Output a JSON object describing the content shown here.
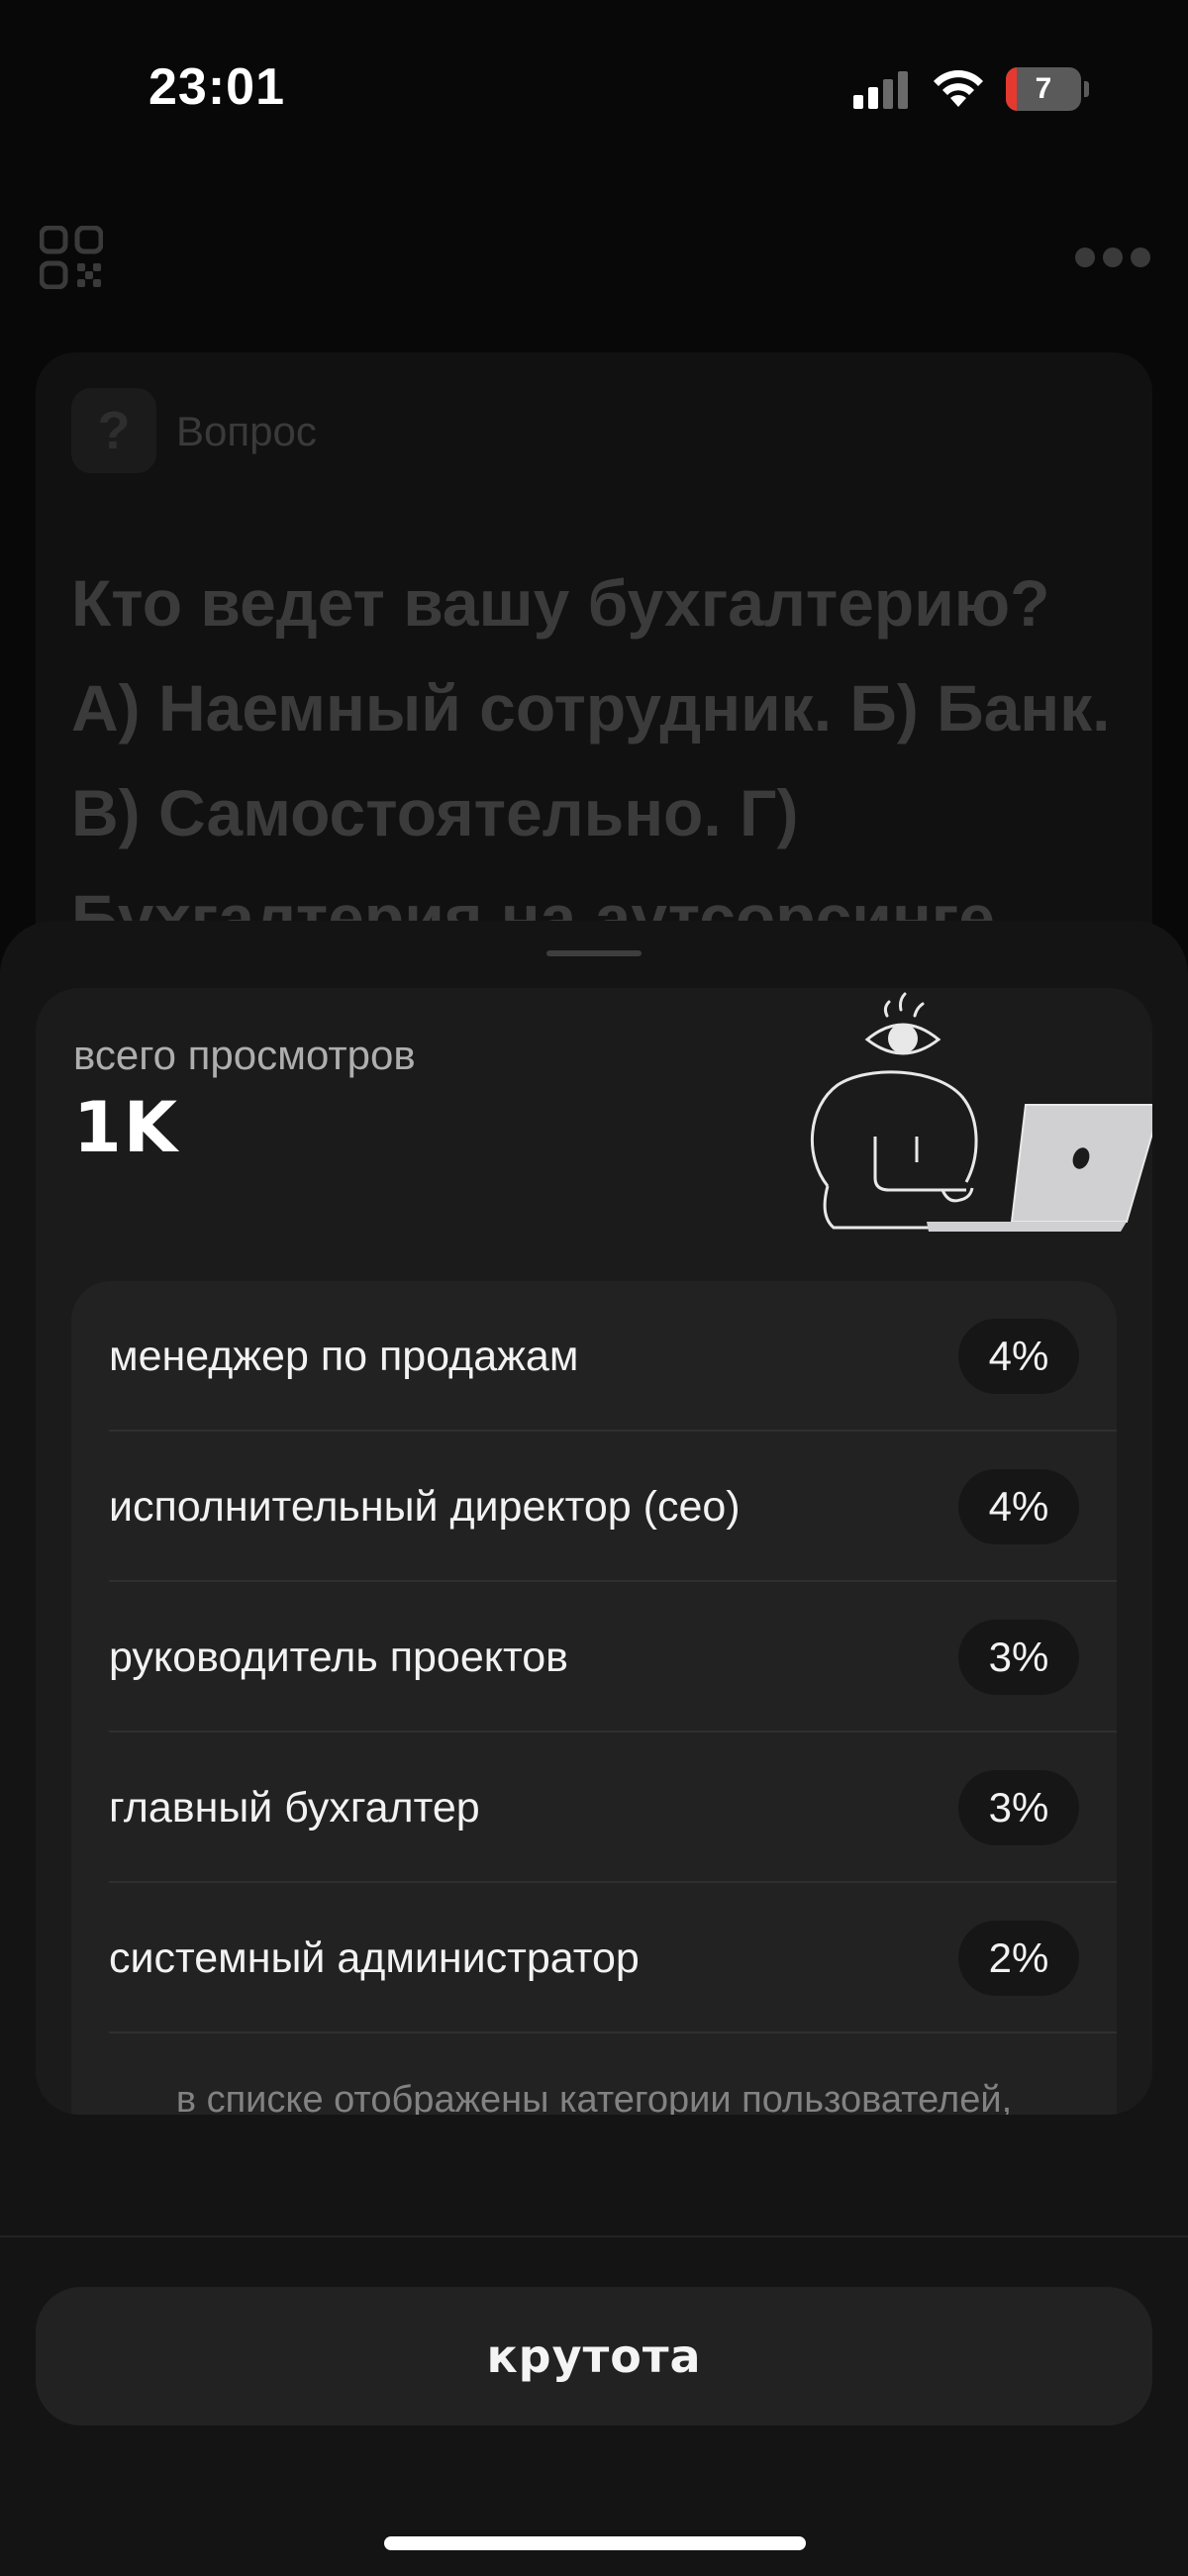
{
  "status_bar": {
    "time": "23:01",
    "battery_level": "7",
    "battery_fraction": 0.07,
    "icons": [
      "cellular-signal-icon",
      "wifi-icon",
      "battery-icon"
    ]
  },
  "background_post": {
    "header_icons": [
      "qr-code-icon",
      "more-dots-icon"
    ],
    "question_badge": "?",
    "question_label": "Вопрос",
    "question_text": "Кто ведет вашу бухгалтерию? А) Наемный сотрудник. Б) Банк. В) Самостоятельно. Г) Бухгалтерия на аутсорсинге"
  },
  "sheet": {
    "views_label": "всего просмотров",
    "views_value": "1K",
    "illustration": "person-with-laptop-illustration",
    "categories": [
      {
        "label": "менеджер по продажам",
        "percent": "4%"
      },
      {
        "label": "исполнительный директор (ceo)",
        "percent": "4%"
      },
      {
        "label": "руководитель проектов",
        "percent": "3%"
      },
      {
        "label": "главный бухгалтер",
        "percent": "3%"
      },
      {
        "label": "системный администратор",
        "percent": "2%"
      }
    ],
    "note": "в списке отображены категории пользователей, которым наиболее часто показывался этот пост",
    "action_label": "крутота"
  },
  "colors": {
    "background": "#080808",
    "sheet": "#141414",
    "card": "#1b1b1b",
    "list": "#222222",
    "battery_low": "#e5392f"
  }
}
